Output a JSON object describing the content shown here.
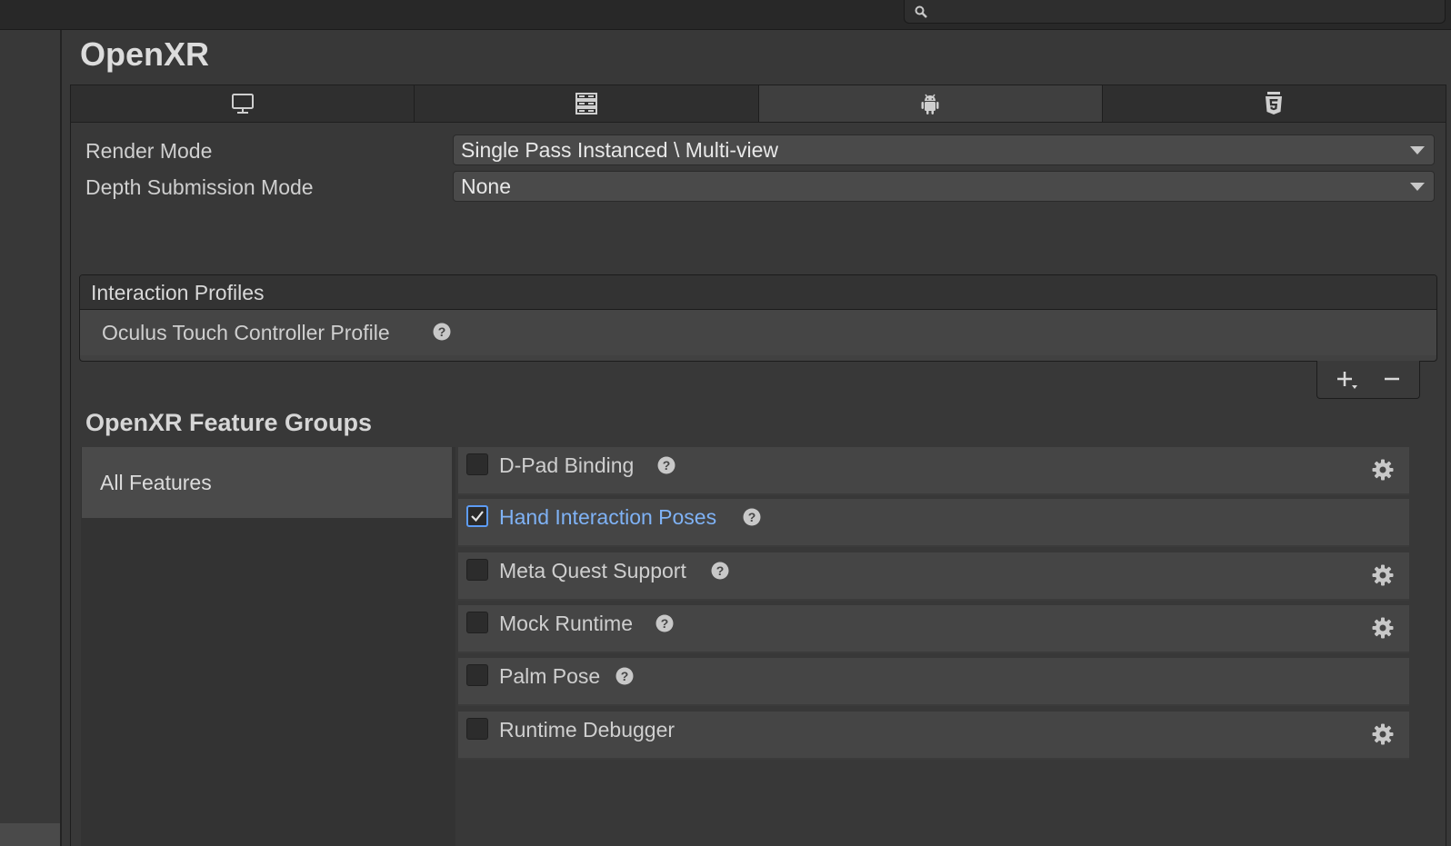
{
  "search": {
    "placeholder": "",
    "value": ""
  },
  "page": {
    "title": "OpenXR"
  },
  "tabs": [
    {
      "name": "standalone",
      "icon": "monitor-icon",
      "active": false
    },
    {
      "name": "server",
      "icon": "server-icon",
      "active": false
    },
    {
      "name": "android",
      "icon": "android-icon",
      "active": true
    },
    {
      "name": "webgl",
      "icon": "html5-icon",
      "active": false
    }
  ],
  "settings": {
    "render_mode": {
      "label": "Render Mode",
      "value": "Single Pass Instanced \\ Multi-view"
    },
    "depth_submission": {
      "label": "Depth Submission Mode",
      "value": "None"
    }
  },
  "interaction_profiles": {
    "header": "Interaction Profiles",
    "items": [
      {
        "label": "Oculus Touch Controller Profile"
      }
    ]
  },
  "feature_groups": {
    "title": "OpenXR Feature Groups",
    "groups": [
      {
        "label": "All Features",
        "selected": true
      }
    ],
    "features": [
      {
        "label": "D-Pad Binding",
        "checked": false,
        "has_settings": true
      },
      {
        "label": "Hand Interaction Poses",
        "checked": true,
        "has_settings": false
      },
      {
        "label": "Meta Quest Support",
        "checked": false,
        "has_settings": true
      },
      {
        "label": "Mock Runtime",
        "checked": false,
        "has_settings": true
      },
      {
        "label": "Palm Pose",
        "checked": false,
        "has_settings": false
      },
      {
        "label": "Runtime Debugger",
        "checked": false,
        "has_settings": true
      }
    ]
  },
  "colors": {
    "accent": "#5d9cf5",
    "active_label": "#7fb2f5",
    "background": "#383838"
  }
}
